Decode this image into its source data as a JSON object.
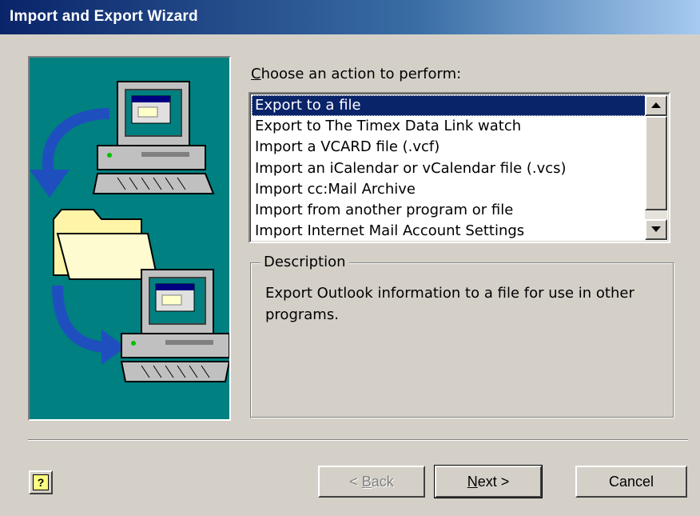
{
  "window": {
    "title": "Import and Export Wizard"
  },
  "prompt": {
    "label_mnemonic": "C",
    "label_rest": "hoose an action to perform:"
  },
  "actions": {
    "selected_index": 0,
    "items": [
      "Export to a file",
      "Export to The Timex Data Link watch",
      "Import a VCARD file (.vcf)",
      "Import an iCalendar or vCalendar file (.vcs)",
      "Import cc:Mail Archive",
      "Import from another program or file",
      "Import Internet Mail Account Settings"
    ]
  },
  "description": {
    "legend": "Description",
    "text": "Export Outlook information to a file for use in other programs."
  },
  "buttons": {
    "back": {
      "prefix": "< ",
      "mnemonic": "B",
      "rest": "ack",
      "enabled": false
    },
    "next": {
      "mnemonic": "N",
      "rest": "ext >"
    },
    "cancel": {
      "label": "Cancel"
    },
    "help": {
      "glyph": "?"
    }
  },
  "illustration": {
    "icons": [
      "computer-icon",
      "folder-icon",
      "computer-icon",
      "arrow-icon"
    ],
    "colors": {
      "background": "#008080",
      "arrow": "#1f4fbf",
      "folder": "#fff4a8"
    }
  },
  "colors": {
    "title_start": "#0a246a",
    "selection": "#0a246a",
    "face": "#d4d0c8"
  }
}
